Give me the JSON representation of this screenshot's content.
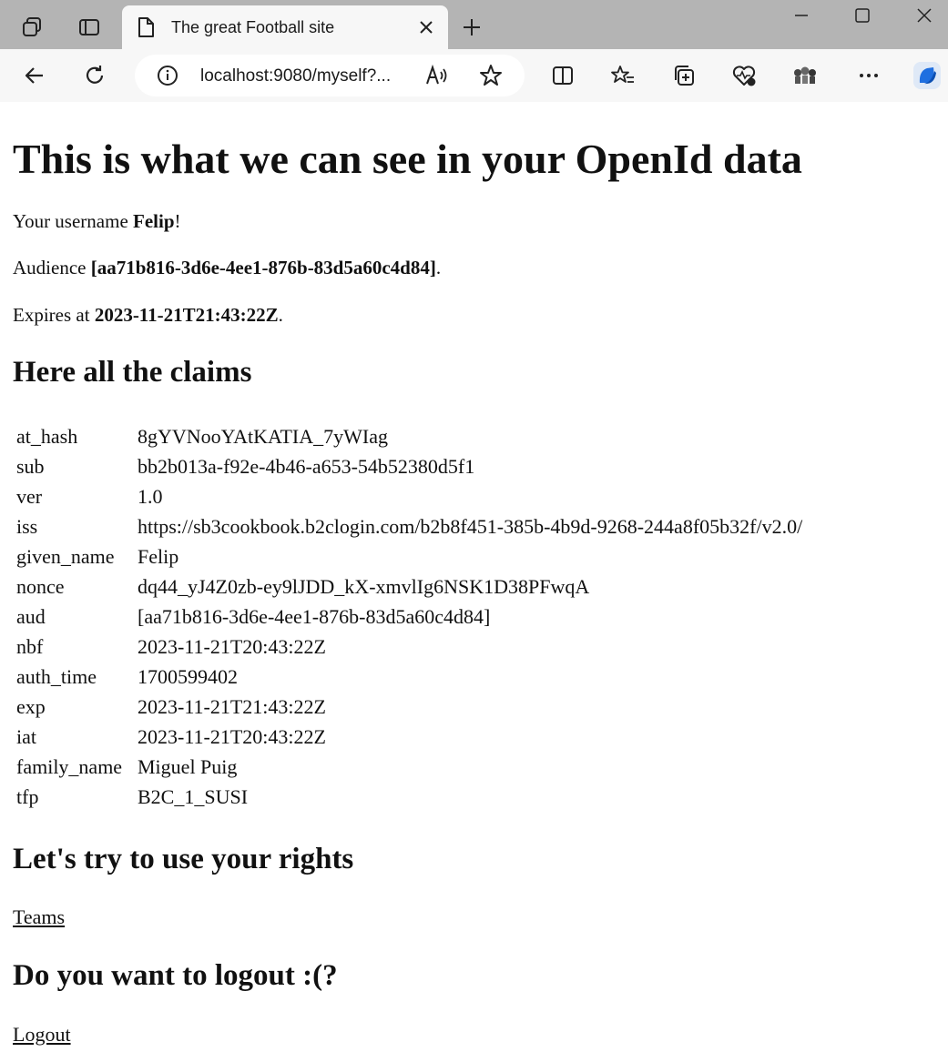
{
  "browser": {
    "tab_title": "The great Football site",
    "url": "localhost:9080/myself?..."
  },
  "page": {
    "title": "This is what we can see in your OpenId data",
    "username_prefix": "Your username ",
    "username": "Felip",
    "username_suffix": "!",
    "audience_prefix": "Audience ",
    "audience": "[aa71b816-3d6e-4ee1-876b-83d5a60c4d84]",
    "audience_suffix": ".",
    "expires_prefix": "Expires at ",
    "expires": "2023-11-21T21:43:22Z",
    "expires_suffix": ".",
    "claims_heading": "Here all the claims",
    "claims": [
      {
        "key": "at_hash",
        "value": "8gYVNooYAtKATIA_7yWIag"
      },
      {
        "key": "sub",
        "value": "bb2b013a-f92e-4b46-a653-54b52380d5f1"
      },
      {
        "key": "ver",
        "value": "1.0"
      },
      {
        "key": "iss",
        "value": "https://sb3cookbook.b2clogin.com/b2b8f451-385b-4b9d-9268-244a8f05b32f/v2.0/"
      },
      {
        "key": "given_name",
        "value": "Felip"
      },
      {
        "key": "nonce",
        "value": "dq44_yJ4Z0zb-ey9lJDD_kX-xmvlIg6NSK1D38PFwqA"
      },
      {
        "key": "aud",
        "value": "[aa71b816-3d6e-4ee1-876b-83d5a60c4d84]"
      },
      {
        "key": "nbf",
        "value": "2023-11-21T20:43:22Z"
      },
      {
        "key": "auth_time",
        "value": "1700599402"
      },
      {
        "key": "exp",
        "value": "2023-11-21T21:43:22Z"
      },
      {
        "key": "iat",
        "value": "2023-11-21T20:43:22Z"
      },
      {
        "key": "family_name",
        "value": "Miguel Puig"
      },
      {
        "key": "tfp",
        "value": "B2C_1_SUSI"
      }
    ],
    "rights_heading": "Let's try to use your rights",
    "teams_link": "Teams",
    "logout_heading": "Do you want to logout :(?",
    "logout_link": "Logout"
  }
}
